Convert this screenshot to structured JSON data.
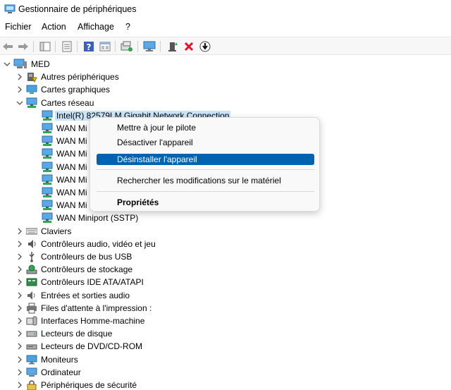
{
  "window": {
    "title": "Gestionnaire de périphériques"
  },
  "menu": [
    "Fichier",
    "Action",
    "Affichage",
    "?"
  ],
  "toolbar": [
    "back-arrow-icon",
    "forward-arrow-icon",
    "console-tree-icon",
    "properties-icon",
    "help-icon",
    "view-icon",
    "monitor-icon",
    "scan-hardware-icon",
    "add-driver-icon",
    "remove-icon",
    "update-driver-icon"
  ],
  "tree": {
    "root": "MED",
    "items": [
      {
        "label": "Autres périphériques",
        "icon": "other-devices-icon",
        "level": 1,
        "expanded": false
      },
      {
        "label": "Cartes graphiques",
        "icon": "display-adapter-icon",
        "level": 1,
        "expanded": false
      },
      {
        "label": "Cartes réseau",
        "icon": "network-adapter-icon",
        "level": 1,
        "expanded": true
      },
      {
        "label": "Intel(R) 82579LM Gigabit Network Connection",
        "icon": "network-adapter-icon",
        "level": 2,
        "selected": true
      },
      {
        "label": "WAN Mi",
        "icon": "network-adapter-icon",
        "level": 2
      },
      {
        "label": "WAN Mi",
        "icon": "network-adapter-icon",
        "level": 2
      },
      {
        "label": "WAN Mi",
        "icon": "network-adapter-icon",
        "level": 2
      },
      {
        "label": "WAN Mi",
        "icon": "network-adapter-icon",
        "level": 2
      },
      {
        "label": "WAN Mi",
        "icon": "network-adapter-icon",
        "level": 2
      },
      {
        "label": "WAN Mi",
        "icon": "network-adapter-icon",
        "level": 2
      },
      {
        "label": "WAN Mi",
        "icon": "network-adapter-icon",
        "level": 2
      },
      {
        "label": "WAN Miniport (SSTP)",
        "icon": "network-adapter-icon",
        "level": 2
      },
      {
        "label": "Claviers",
        "icon": "keyboard-icon",
        "level": 1,
        "expanded": false
      },
      {
        "label": "Contrôleurs audio, vidéo et jeu",
        "icon": "audio-icon",
        "level": 1,
        "expanded": false
      },
      {
        "label": "Contrôleurs de bus USB",
        "icon": "usb-icon",
        "level": 1,
        "expanded": false
      },
      {
        "label": "Contrôleurs de stockage",
        "icon": "storage-icon",
        "level": 1,
        "expanded": false
      },
      {
        "label": "Contrôleurs IDE ATA/ATAPI",
        "icon": "ide-icon",
        "level": 1,
        "expanded": false
      },
      {
        "label": "Entrées et sorties audio",
        "icon": "speaker-icon",
        "level": 1,
        "expanded": false
      },
      {
        "label": "Files d'attente à l'impression :",
        "icon": "printer-icon",
        "level": 1,
        "expanded": false
      },
      {
        "label": "Interfaces Homme-machine",
        "icon": "hid-icon",
        "level": 1,
        "expanded": false
      },
      {
        "label": "Lecteurs de disque",
        "icon": "disk-drive-icon",
        "level": 1,
        "expanded": false
      },
      {
        "label": "Lecteurs de DVD/CD-ROM",
        "icon": "dvd-icon",
        "level": 1,
        "expanded": false
      },
      {
        "label": "Moniteurs",
        "icon": "monitor-icon",
        "level": 1,
        "expanded": false
      },
      {
        "label": "Ordinateur",
        "icon": "computer-icon",
        "level": 1,
        "expanded": false
      },
      {
        "label": "Périphériques de sécurité",
        "icon": "security-device-icon",
        "level": 1,
        "expanded": false
      }
    ]
  },
  "context_menu": {
    "update_driver": "Mettre à jour le pilote",
    "disable_device": "Désactiver l'appareil",
    "uninstall_device": "Désinstaller l'appareil",
    "scan_hardware": "Rechercher les modifications sur le matériel",
    "properties": "Propriétés"
  },
  "colors": {
    "highlight": "#0063b1",
    "selection": "#cce4f7",
    "accent_red": "#e81123"
  }
}
